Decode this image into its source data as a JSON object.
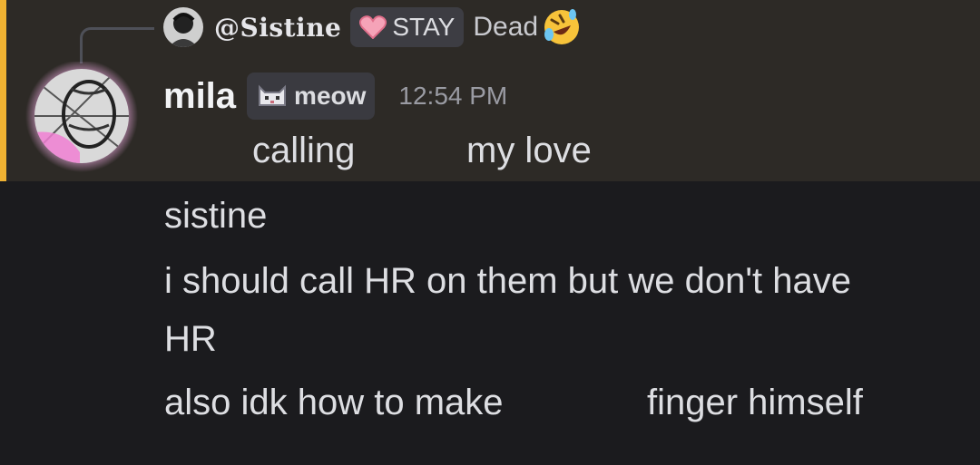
{
  "reply": {
    "username": "@Sistine",
    "tag": "STAY",
    "text": "Dead",
    "emoji": "rolling-on-floor-laughing"
  },
  "message": {
    "author": "mila",
    "role_tag": "meow",
    "time": "12:54 PM",
    "first_line": [
      "calling",
      "my love"
    ]
  },
  "followups": {
    "line1": "sistine",
    "line2a": "i should call HR on them but we don't have",
    "line2b": "HR",
    "line3": [
      "also idk how to make",
      "finger himself"
    ]
  },
  "colors": {
    "highlight_bg": "#2d2a26",
    "highlight_bar": "#f0b232",
    "page_bg": "#1b1b1e"
  }
}
